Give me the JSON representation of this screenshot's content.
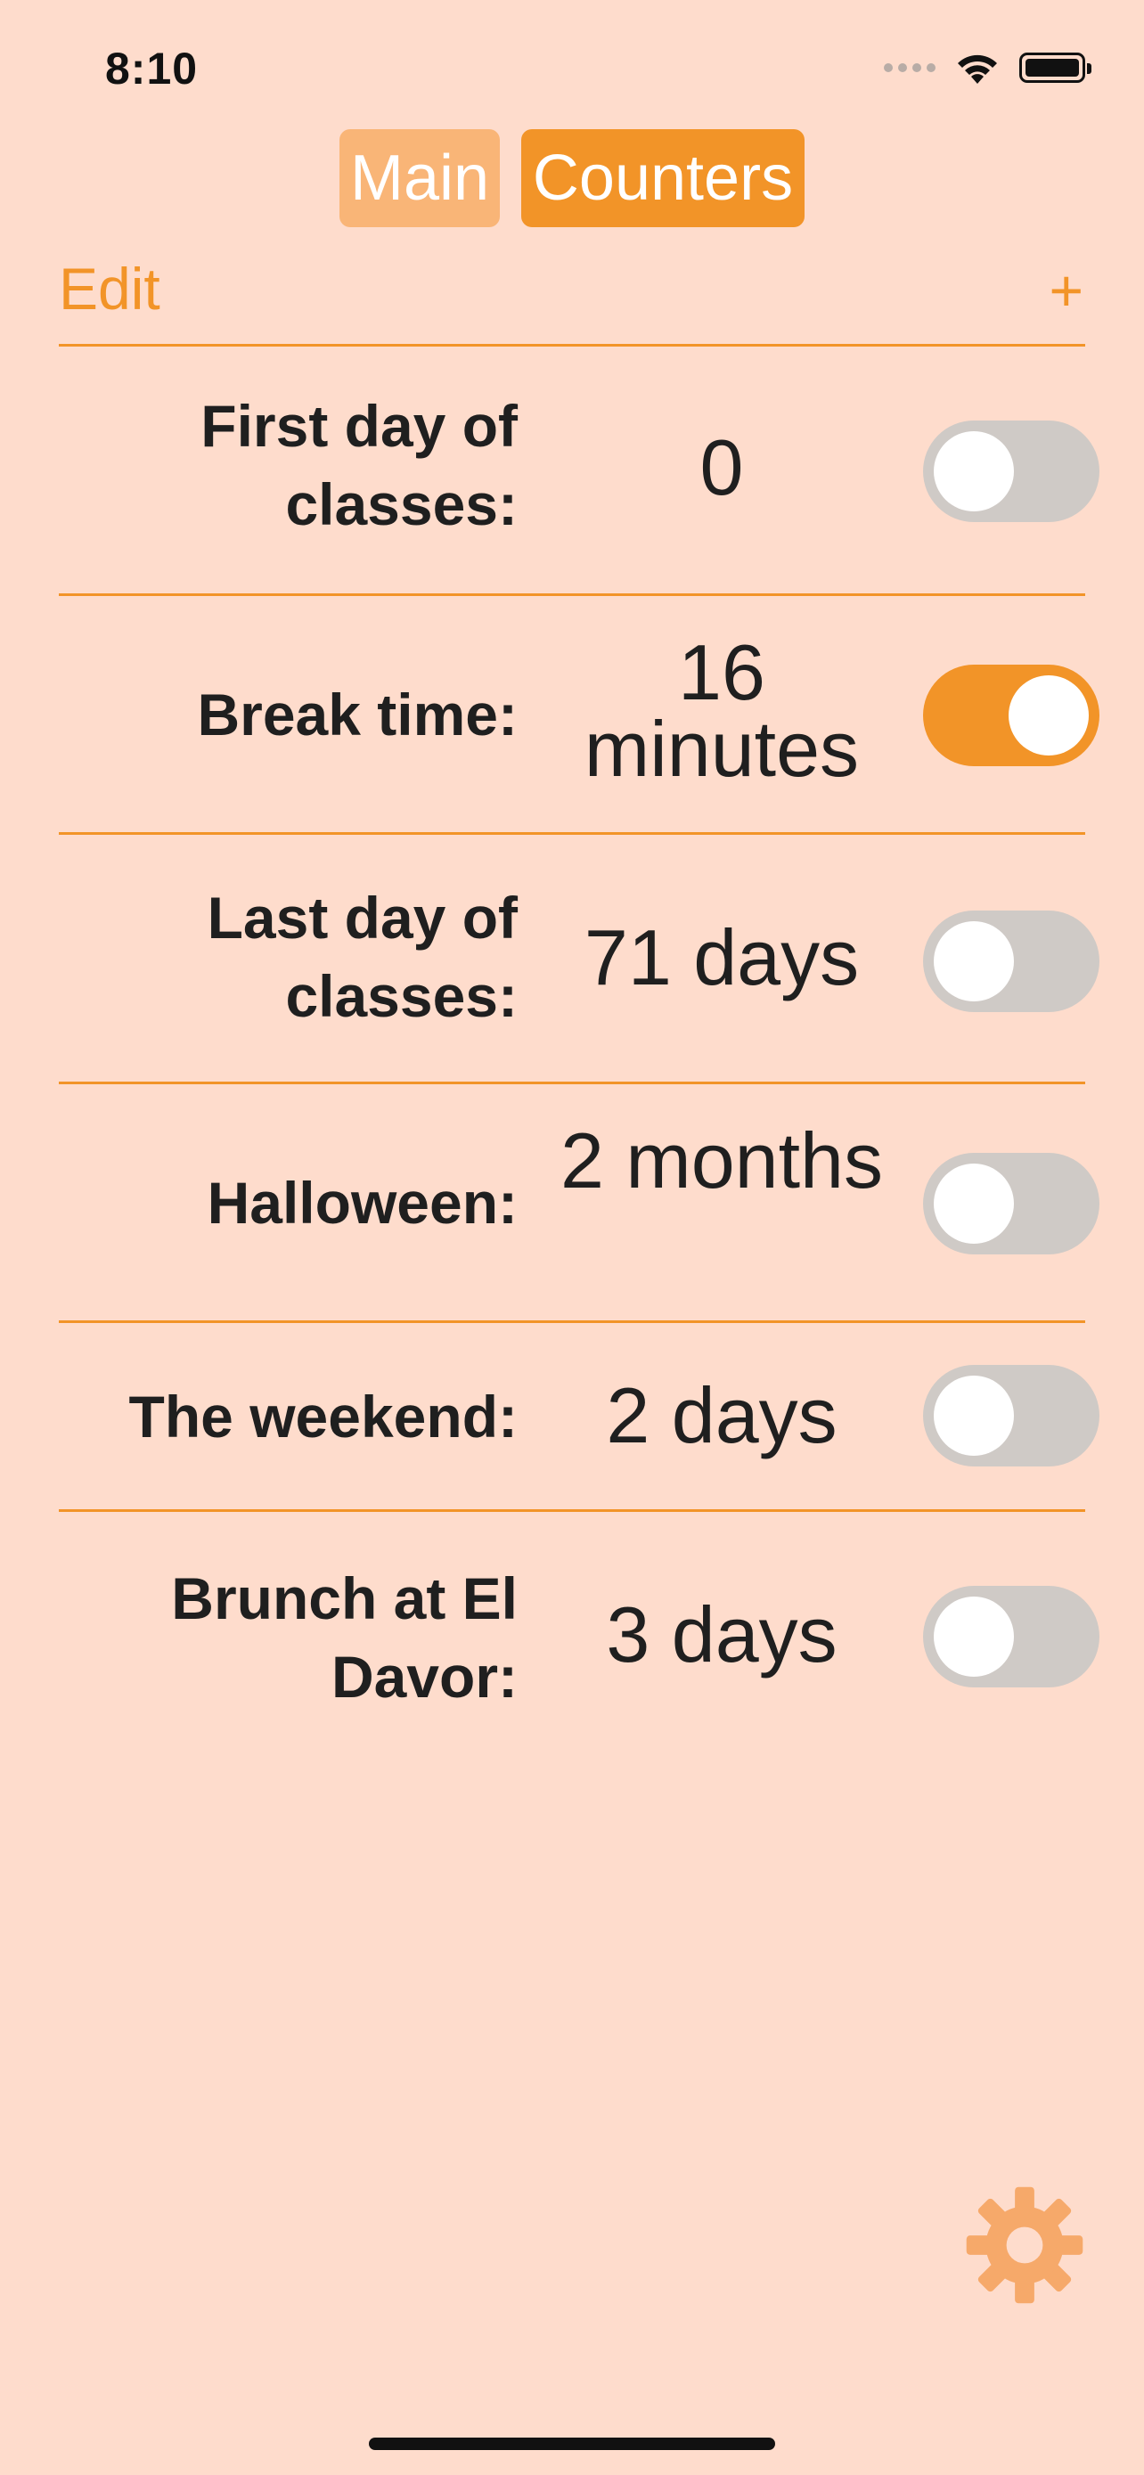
{
  "status_bar": {
    "time": "8:10"
  },
  "tabs": [
    {
      "label": "Main",
      "selected": false
    },
    {
      "label": "Counters",
      "selected": true
    }
  ],
  "toolbar": {
    "edit_label": "Edit",
    "add_label": "+"
  },
  "counters": [
    {
      "label": "First day of classes:",
      "value": "0",
      "enabled": false
    },
    {
      "label": "Break time:",
      "value": "16 minutes",
      "enabled": true
    },
    {
      "label": "Last day of classes:",
      "value": "71 days",
      "enabled": false
    },
    {
      "label": "Halloween:",
      "value": "2 months",
      "enabled": false
    },
    {
      "label": "The weekend:",
      "value": "2 days",
      "enabled": false
    },
    {
      "label": "Brunch at El Davor:",
      "value": "3 days",
      "enabled": false
    }
  ],
  "settings": {
    "icon": "gear-icon"
  },
  "colors": {
    "background": "#FEDCCC",
    "accent": "#F29428",
    "accent_light": "#F9B577",
    "toggle_off": "#CFCAC6"
  }
}
